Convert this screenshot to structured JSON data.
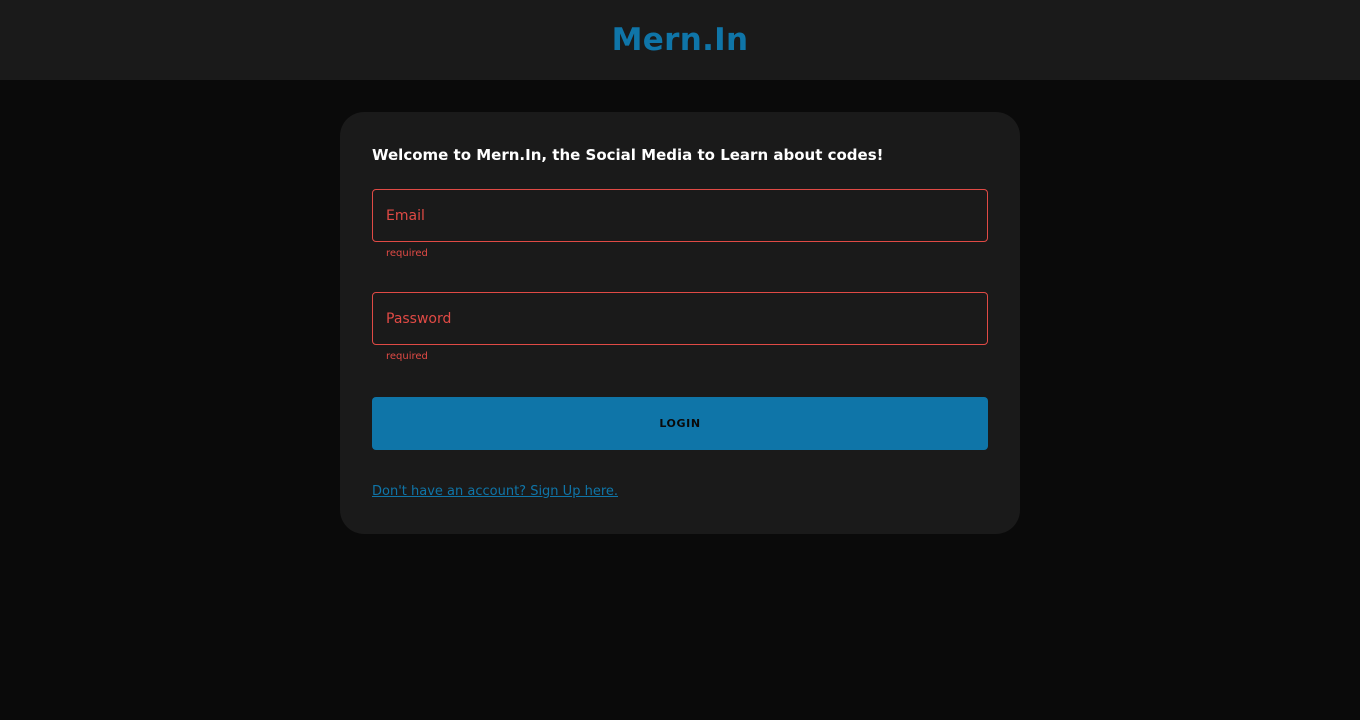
{
  "navbar": {
    "brand": "Mern.In"
  },
  "login_form": {
    "welcome": "Welcome to Mern.In, the Social Media to Learn about codes!",
    "email": {
      "value": "",
      "placeholder": "Email",
      "helper": "required"
    },
    "password": {
      "value": "",
      "placeholder": "Password",
      "helper": "required"
    },
    "login_label": "LOGIN",
    "signup_link": "Don't have an account? Sign Up here."
  },
  "colors": {
    "accent": "#0f75a8",
    "error": "#e04a45",
    "background": "#0a0a0a",
    "surface": "#1a1a1a"
  }
}
